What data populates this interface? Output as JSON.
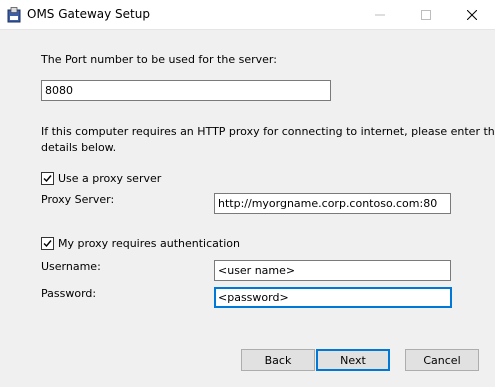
{
  "window": {
    "title": "OMS Gateway Setup",
    "minimize_icon": "minimize-icon",
    "maximize_icon": "maximize-icon",
    "close_icon": "close-icon"
  },
  "port": {
    "label": "The Port number to be used for the server:",
    "value": "8080"
  },
  "proxy_info": {
    "line1": "If this computer requires an HTTP proxy for connecting to internet, please enter the",
    "line2": "details below."
  },
  "use_proxy": {
    "label": "Use a proxy server",
    "checked": true
  },
  "proxy_server": {
    "label": "Proxy Server:",
    "value": "http://myorgname.corp.contoso.com:80"
  },
  "auth": {
    "label": "My proxy requires authentication",
    "checked": true
  },
  "username": {
    "label": "Username:",
    "value": "<user name>"
  },
  "password": {
    "label": "Password:",
    "value": "<password>"
  },
  "buttons": {
    "back": "Back",
    "next": "Next",
    "cancel": "Cancel"
  },
  "colors": {
    "accent": "#0078d7",
    "background": "#f0f0f0"
  }
}
